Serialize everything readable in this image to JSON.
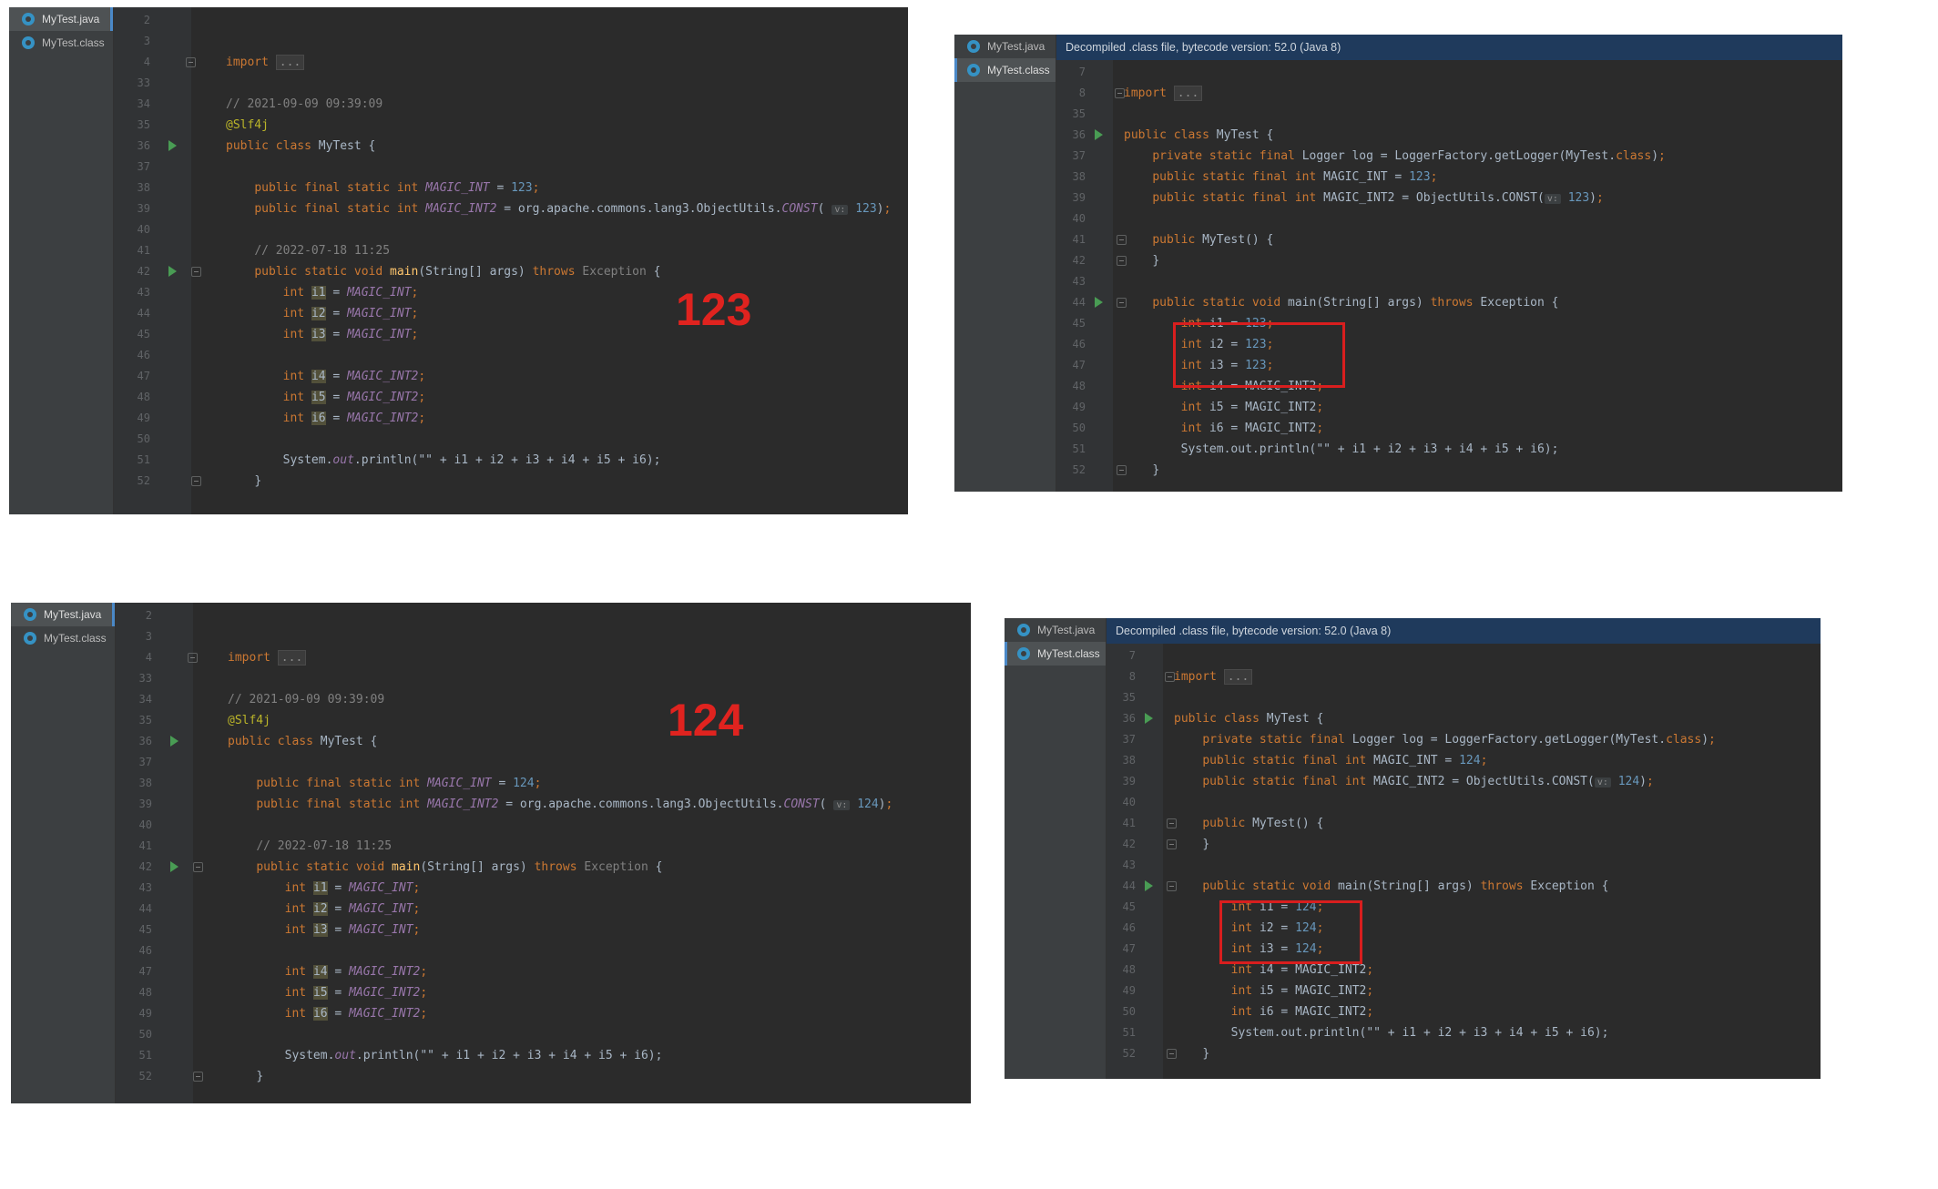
{
  "tabs": {
    "java": "MyTest.java",
    "cls": "MyTest.class"
  },
  "banner": "Decompiled .class file, bytecode version: 52.0 (Java 8)",
  "source": {
    "import_kw": "import",
    "import_fold": "...",
    "c1": "// 2021-09-09 09:39:09",
    "anno": "@Slf4j",
    "class_line": "MyTest {",
    "mods": "public final static int",
    "magic": "MAGIC_INT",
    "magic2": "MAGIC_INT2",
    "objutils": " = org.apache.commons.lang3.ObjectUtils.",
    "const": "CONST",
    "v": "v:",
    "c2": "// 2022-07-18 11:25",
    "println_pre": "System.",
    "out": "out",
    "println_post": ".println(\"\" + i1 + i2 + i3 + i4 + i5 + i6);"
  },
  "decompiled": {
    "logger": "Logger log = LoggerFactory.getLogger(MyTest.",
    "class_kw": "class",
    "mods": "public static final int",
    "objutils": " = ObjectUtils.CONST(",
    "ctor": "MyTest() {",
    "println": "System.out.println(\"\" + i1 + i2 + i3 + i4 + i5 + i6);"
  },
  "panels": [
    {
      "label": "123",
      "value": "123"
    },
    {
      "label": "124",
      "value": "124"
    }
  ],
  "src_line_numbers": [
    "2",
    "3",
    "4",
    "33",
    "34",
    "35",
    "36",
    "37",
    "38",
    "39",
    "40",
    "41",
    "42",
    "43",
    "44",
    "45",
    "46",
    "47",
    "48",
    "49",
    "50",
    "51",
    "52"
  ],
  "dec_line_numbers": [
    "7",
    "8",
    "35",
    "36",
    "37",
    "38",
    "39",
    "40",
    "41",
    "42",
    "43",
    "44",
    "45",
    "46",
    "47",
    "48",
    "49",
    "50",
    "51",
    "52"
  ]
}
